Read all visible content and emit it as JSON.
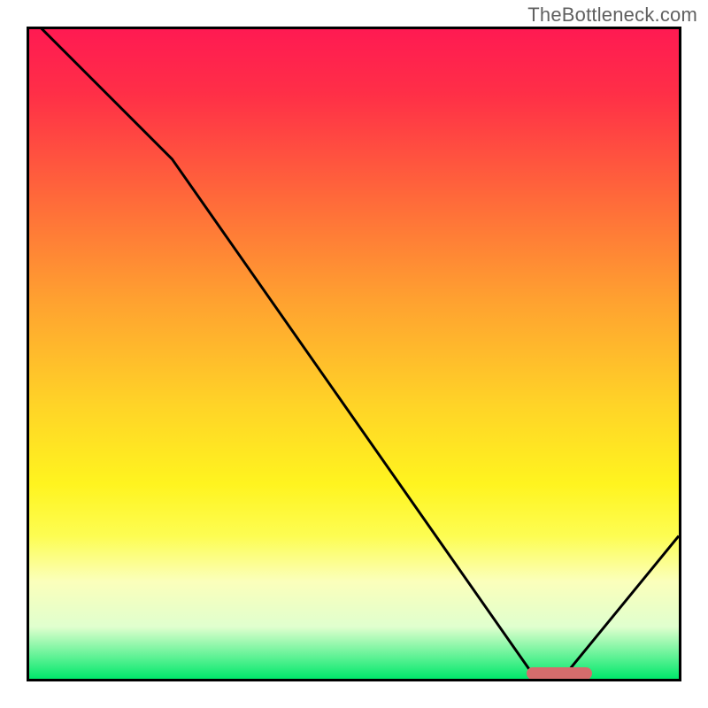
{
  "watermark": "TheBottleneck.com",
  "chart_data": {
    "type": "line",
    "title": "",
    "xlabel": "",
    "ylabel": "",
    "xlim": [
      0,
      100
    ],
    "ylim": [
      0,
      100
    ],
    "grid": false,
    "series": [
      {
        "name": "bottleneck-curve",
        "x": [
          0,
          22,
          78,
          82,
          100
        ],
        "values": [
          102,
          80,
          0,
          0,
          22
        ]
      }
    ],
    "optimal_marker": {
      "x_start": 76,
      "x_end": 86,
      "y": 0
    },
    "background": "red-yellow-green vertical gradient (red top, green bottom)",
    "colors": {
      "curve": "#000000",
      "marker": "#d56c6c"
    }
  }
}
